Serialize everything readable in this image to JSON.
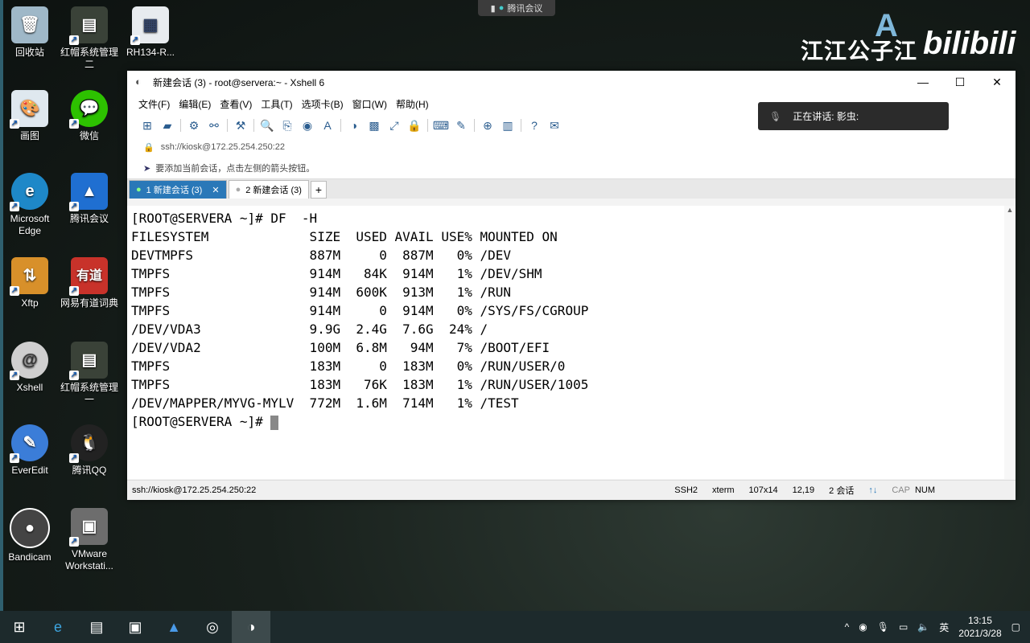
{
  "desktop": {
    "icons": [
      {
        "label": "回收站",
        "icon": "recycle-bin-icon"
      },
      {
        "label": "红帽系统管理二",
        "icon": "book-icon"
      },
      {
        "label": "RH134-R...",
        "icon": "document-icon"
      },
      {
        "label": "画图",
        "icon": "paint-icon"
      },
      {
        "label": "微信",
        "icon": "wechat-icon"
      },
      {
        "label": "Microsoft Edge",
        "icon": "edge-icon"
      },
      {
        "label": "腾讯会议",
        "icon": "tencent-meeting-icon"
      },
      {
        "label": "Xftp",
        "icon": "xftp-icon"
      },
      {
        "label": "网易有道词典",
        "icon": "youdao-icon"
      },
      {
        "label": "Xshell",
        "icon": "xshell-icon"
      },
      {
        "label": "红帽系统管理一",
        "icon": "book-icon"
      },
      {
        "label": "EverEdit",
        "icon": "everedit-icon"
      },
      {
        "label": "腾讯QQ",
        "icon": "qq-icon"
      },
      {
        "label": "Bandicam",
        "icon": "bandicam-icon"
      },
      {
        "label": "VMware Workstati...",
        "icon": "vmware-icon"
      }
    ],
    "youdao_glyph": "有道"
  },
  "meeting_bar": {
    "label": "腾讯会议"
  },
  "watermark": {
    "chinese": "江江公子江",
    "brand": "bilibili"
  },
  "window": {
    "title": "新建会话 (3) - root@servera:~ - Xshell 6",
    "menu": [
      "文件(F)",
      "编辑(E)",
      "查看(V)",
      "工具(T)",
      "选项卡(B)",
      "窗口(W)",
      "帮助(H)"
    ],
    "address": "ssh://kiosk@172.25.254.250:22",
    "hint": "要添加当前会话，点击左侧的箭头按钮。",
    "tabs": [
      {
        "label": "1 新建会话 (3)",
        "active": true
      },
      {
        "label": "2 新建会话 (3)",
        "active": false
      }
    ],
    "terminal_lines": [
      "[ROOT@SERVERA ~]# DF  -H",
      "FILESYSTEM             SIZE  USED AVAIL USE% MOUNTED ON",
      "DEVTMPFS               887M     0  887M   0% /DEV",
      "TMPFS                  914M   84K  914M   1% /DEV/SHM",
      "TMPFS                  914M  600K  913M   1% /RUN",
      "TMPFS                  914M     0  914M   0% /SYS/FS/CGROUP",
      "/DEV/VDA3              9.9G  2.4G  7.6G  24% /",
      "/DEV/VDA2              100M  6.8M   94M   7% /BOOT/EFI",
      "TMPFS                  183M     0  183M   0% /RUN/USER/0",
      "TMPFS                  183M   76K  183M   1% /RUN/USER/1005",
      "/DEV/MAPPER/MYVG-MYLV  772M  1.6M  714M   1% /TEST"
    ],
    "prompt": "[ROOT@SERVERA ~]# ",
    "status": {
      "address": "ssh://kiosk@172.25.254.250:22",
      "protocol": "SSH2",
      "term": "xterm",
      "size": "107x14",
      "position": "12,19",
      "sessions": "2 会话",
      "caps": "CAP",
      "num": "NUM"
    }
  },
  "speaking": {
    "label": "正在讲话: 影虫:"
  },
  "tray": {
    "lang": "英",
    "time": "13:15",
    "date": "2021/3/28"
  }
}
